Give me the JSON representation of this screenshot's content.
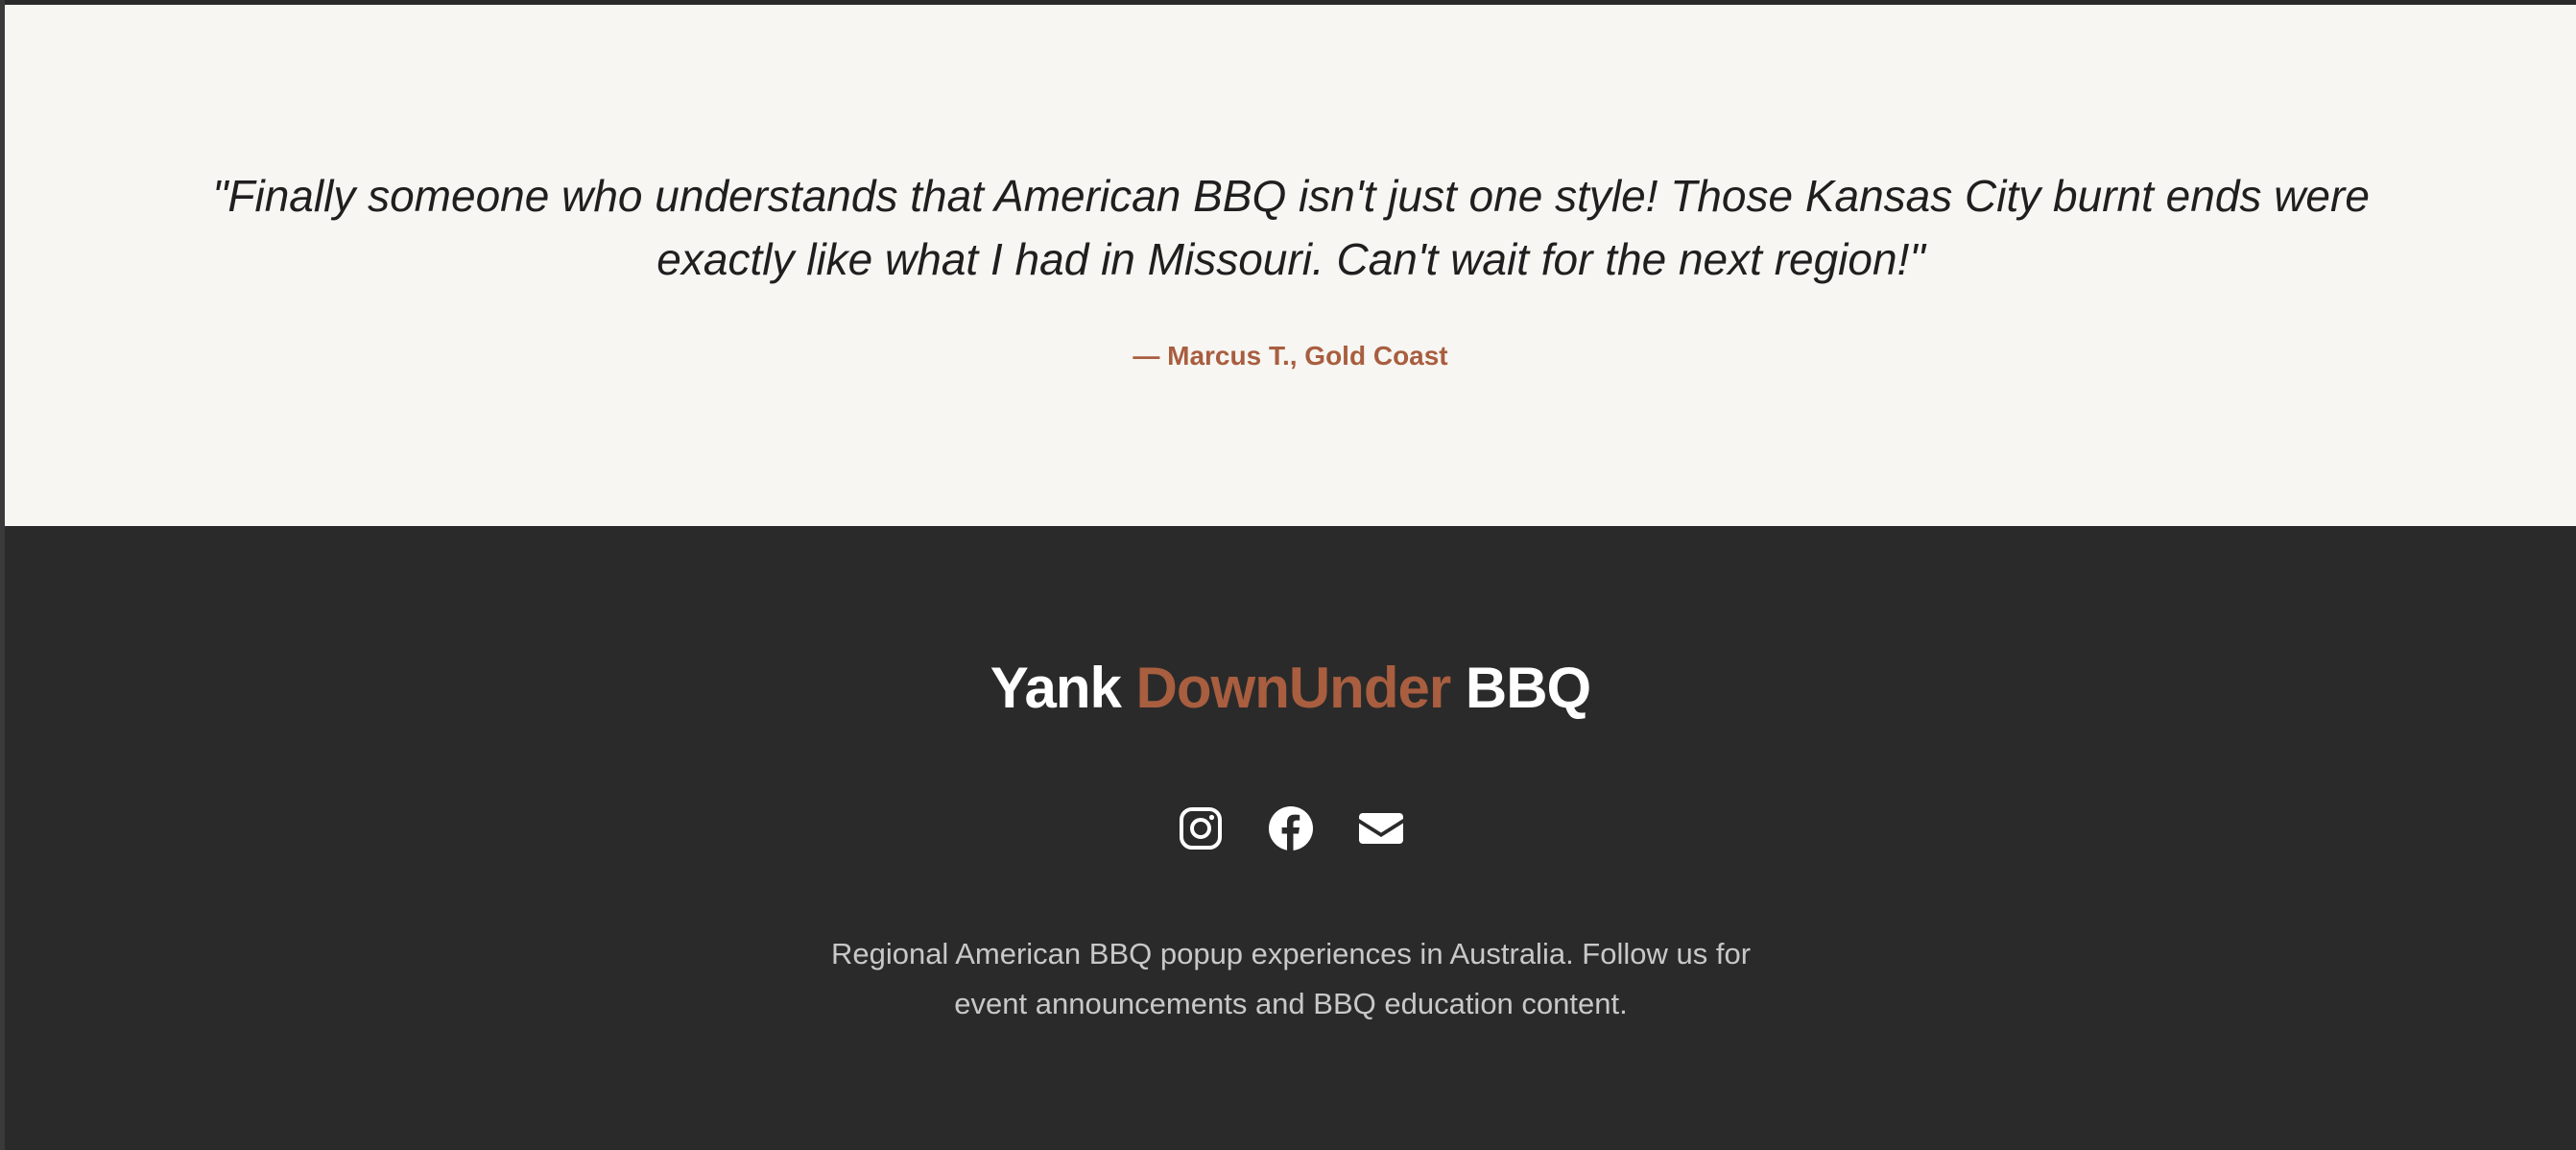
{
  "testimonial": {
    "quote": "\"Finally someone who understands that American BBQ isn't just one style! Those Kansas City burnt ends were exactly like what I had in Missouri. Can't wait for the next region!\"",
    "author": "— Marcus T., Gold Coast"
  },
  "footer": {
    "brand": {
      "part1": "Yank",
      "accent": "DownUnder",
      "part3": "BBQ"
    },
    "social_icons": [
      "instagram-icon",
      "facebook-icon",
      "envelope-icon"
    ],
    "description": "Regional American BBQ popup experiences in Australia. Follow us for event announcements and BBQ education content."
  },
  "colors": {
    "accent": "#a85e3f",
    "testimonial_bg": "#f7f6f2",
    "footer_bg": "#2a2a2a"
  }
}
